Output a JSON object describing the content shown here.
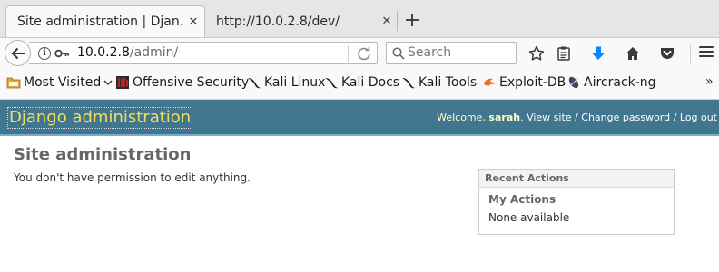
{
  "browser": {
    "tabs": [
      {
        "label": "Site administration | Djan…",
        "active": true
      },
      {
        "label": "http://10.0.2.8/dev/",
        "active": false
      }
    ],
    "url": {
      "host": "10.0.2.8",
      "path": "/admin/"
    },
    "search_placeholder": "Search",
    "bookmarks": [
      {
        "label": "Most Visited",
        "icon": "most-visited-icon"
      },
      {
        "label": "Offensive Security",
        "icon": "offsec-icon"
      },
      {
        "label": "Kali Linux",
        "icon": "kali-dragon-icon"
      },
      {
        "label": "Kali Docs",
        "icon": "kali-dragon-icon"
      },
      {
        "label": "Kali Tools",
        "icon": "kali-dragon-icon"
      },
      {
        "label": "Exploit-DB",
        "icon": "exploit-db-icon"
      },
      {
        "label": "Aircrack-ng",
        "icon": "aircrack-icon"
      }
    ],
    "colors": {
      "download_arrow": "#0a84ff"
    }
  },
  "django": {
    "branding": "Django administration",
    "user_tools": {
      "welcome": "Welcome,",
      "username": "sarah",
      "period": ".",
      "view_site": "View site",
      "separator": "/",
      "change_password": "Change password",
      "log_out": "Log out"
    },
    "colors": {
      "header_bg": "#417690",
      "brand": "#f5dd5d"
    }
  },
  "content": {
    "title": "Site administration",
    "message": "You don't have permission to edit anything.",
    "recent_actions": {
      "heading": "Recent Actions",
      "subheading": "My Actions",
      "empty_text": "None available"
    }
  }
}
